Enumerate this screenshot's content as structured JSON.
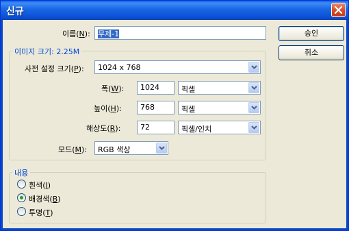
{
  "window": {
    "title": "신규"
  },
  "name": {
    "label": "이름",
    "mnemonic": "N",
    "value": "무제-1"
  },
  "buttons": {
    "ok": "승인",
    "cancel": "취소"
  },
  "image_size": {
    "title": "이미지 크기:",
    "value": "2.25M"
  },
  "preset": {
    "label": "사전 설정 크기",
    "mnemonic": "P",
    "value": "1024 x 768"
  },
  "width": {
    "label": "폭",
    "mnemonic": "W",
    "value": "1024",
    "unit": "픽셀"
  },
  "height": {
    "label": "높이",
    "mnemonic": "H",
    "value": "768",
    "unit": "픽셀"
  },
  "resolution": {
    "label": "해상도",
    "mnemonic": "R",
    "value": "72",
    "unit": "픽셀/인치"
  },
  "mode": {
    "label": "모드",
    "mnemonic": "M",
    "value": "RGB 색상"
  },
  "contents": {
    "title": "내용",
    "options": [
      {
        "label": "흰색",
        "mnemonic": "I",
        "checked": false
      },
      {
        "label": "배경색",
        "mnemonic": "B",
        "checked": true
      },
      {
        "label": "투명",
        "mnemonic": "T",
        "checked": false
      }
    ]
  },
  "colors": {
    "titlebar": "#0a5fe8",
    "face": "#ece9d8",
    "group_title": "#0046d5",
    "selection": "#316ac5"
  }
}
